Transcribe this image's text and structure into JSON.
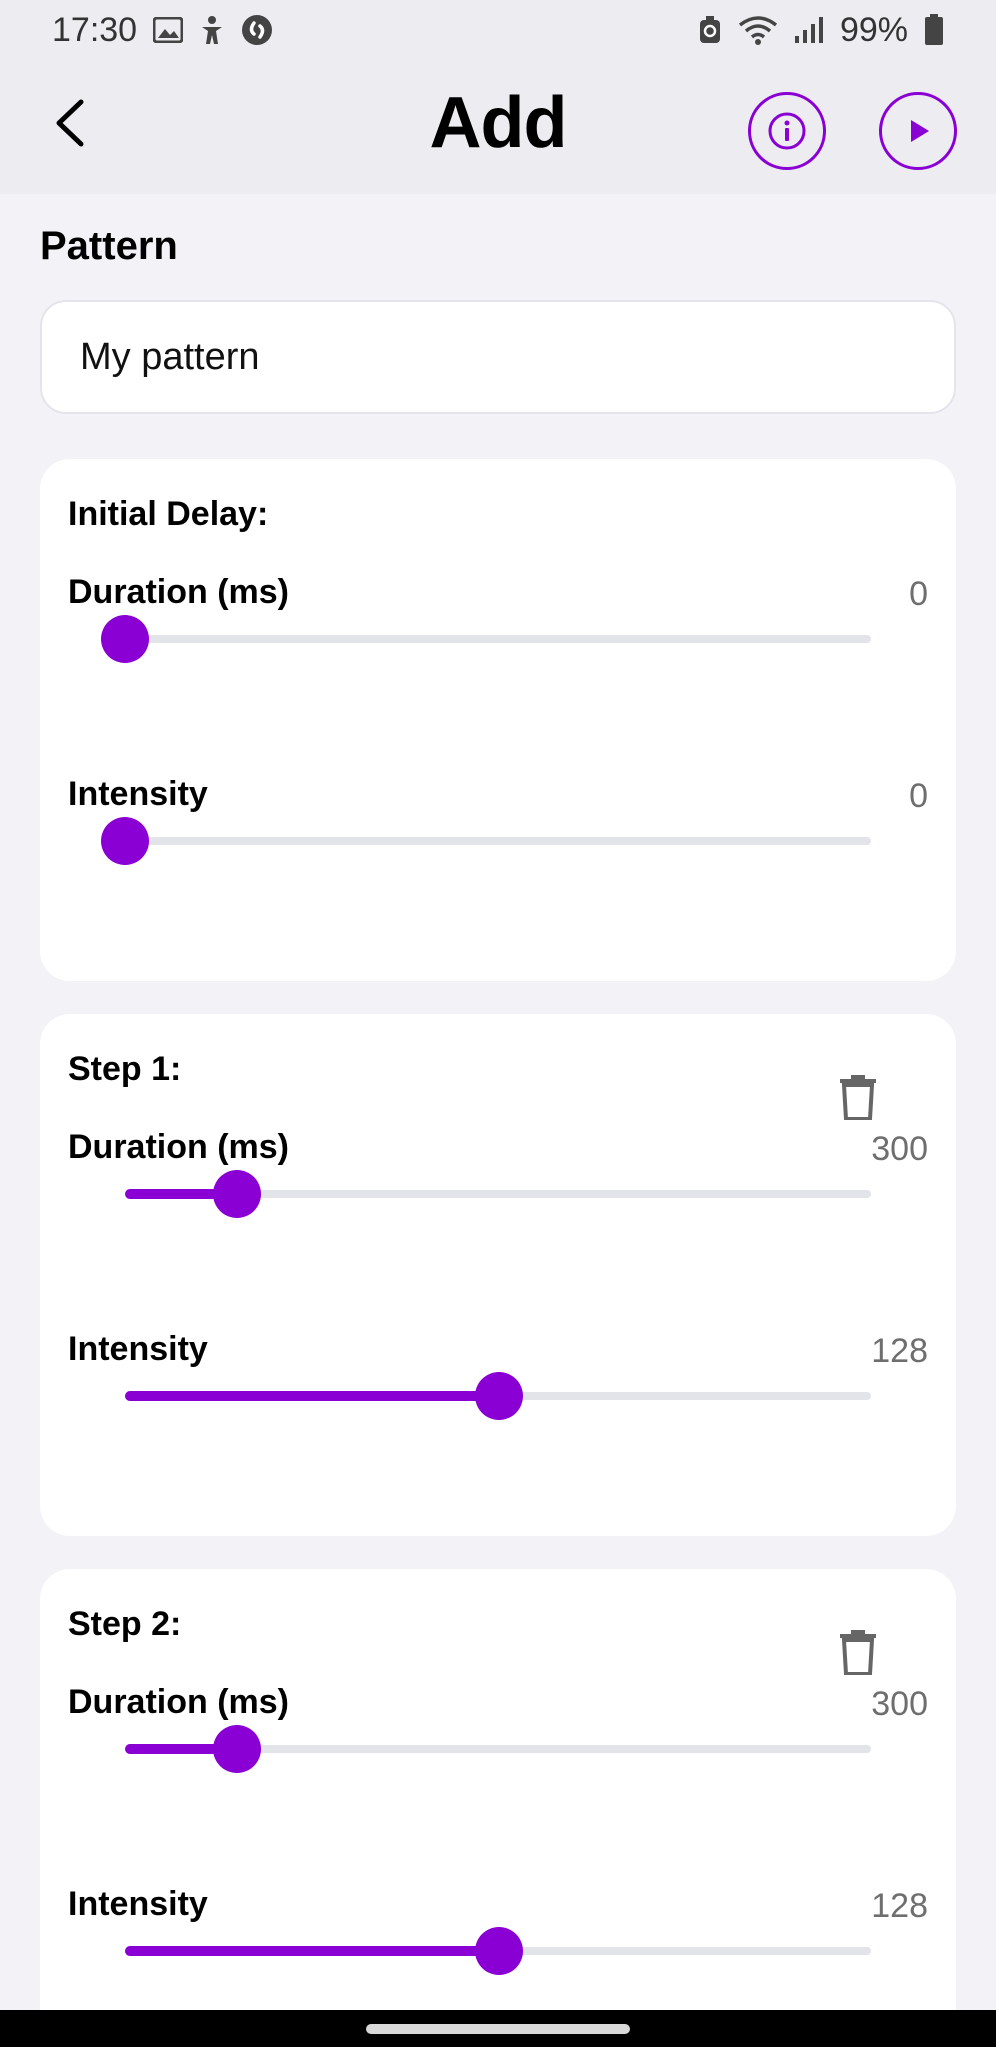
{
  "status_bar": {
    "time": "17:30",
    "battery": "99%",
    "icons": [
      "gallery-icon",
      "accessibility-icon",
      "shazam-icon",
      "nfc-icon",
      "wifi-icon",
      "signal-icon",
      "battery-icon"
    ]
  },
  "header": {
    "title": "Add",
    "back_icon": "chevron-left-icon",
    "info_icon": "info-icon",
    "play_icon": "play-icon"
  },
  "pattern": {
    "label": "Pattern",
    "name_value": "My pattern"
  },
  "cards": [
    {
      "title": "Initial Delay:",
      "deletable": false,
      "duration_label": "Duration (ms)",
      "duration_value": "0",
      "duration_fraction": 0.0,
      "intensity_label": "Intensity",
      "intensity_value": "0",
      "intensity_fraction": 0.0
    },
    {
      "title": "Step 1:",
      "deletable": true,
      "duration_label": "Duration (ms)",
      "duration_value": "300",
      "duration_fraction": 0.15,
      "intensity_label": "Intensity",
      "intensity_value": "128",
      "intensity_fraction": 0.502
    },
    {
      "title": "Step 2:",
      "deletable": true,
      "duration_label": "Duration (ms)",
      "duration_value": "300",
      "duration_fraction": 0.15,
      "intensity_label": "Intensity",
      "intensity_value": "128",
      "intensity_fraction": 0.502
    }
  ],
  "colors": {
    "accent": "#8a00d4",
    "background": "#f2f2f7",
    "track": "#e3e3ea",
    "value_text": "#6e6e6e"
  }
}
